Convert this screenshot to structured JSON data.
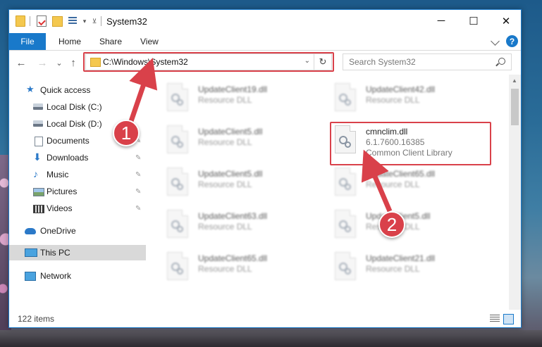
{
  "window": {
    "title": "System32",
    "controls": {
      "minimize": "─",
      "maximize": "☐",
      "close": "✕"
    }
  },
  "ribbon": {
    "file_tab": "File",
    "tabs": [
      "Home",
      "Share",
      "View"
    ],
    "help": "?"
  },
  "address_bar": {
    "path": "C:\\Windows\\System32",
    "refresh_glyph": "↻",
    "dropdown_glyph": "⌄",
    "search_placeholder": "Search System32"
  },
  "nav_buttons": {
    "back": "←",
    "forward": "→",
    "recent": "⌄",
    "up": "↑"
  },
  "nav_pane": {
    "items": [
      {
        "label": "Quick access",
        "icon": "star-icon",
        "pinned": false
      },
      {
        "label": "Local Disk (C:)",
        "icon": "drive-icon",
        "pinned": false
      },
      {
        "label": "Local Disk (D:)",
        "icon": "drive-icon",
        "pinned": false
      },
      {
        "label": "Documents",
        "icon": "documents-icon",
        "pinned": true
      },
      {
        "label": "Downloads",
        "icon": "download-icon",
        "pinned": true
      },
      {
        "label": "Music",
        "icon": "music-icon",
        "pinned": true
      },
      {
        "label": "Pictures",
        "icon": "pictures-icon",
        "pinned": true
      },
      {
        "label": "Videos",
        "icon": "videos-icon",
        "pinned": true
      },
      {
        "label": "OneDrive",
        "icon": "cloud-icon",
        "pinned": false
      },
      {
        "label": "This PC",
        "icon": "pc-icon",
        "pinned": false,
        "selected": true
      },
      {
        "label": "Network",
        "icon": "network-icon",
        "pinned": false
      }
    ],
    "pin_glyph": "📌"
  },
  "files": [
    {
      "name": "UpdateClient19.dll",
      "type": "Resource DLL"
    },
    {
      "name": "UpdateClient42.dll",
      "type": "Resource DLL"
    },
    {
      "name": "UpdateClient5.dll",
      "type": "Resource DLL"
    },
    {
      "name": "cmnclim.dll",
      "type": "6.1.7600.16385",
      "description": "Common Client Library",
      "highlighted": true
    },
    {
      "name": "UpdateClient5.dll",
      "type": "Resource DLL"
    },
    {
      "name": "UpdateClient65.dll",
      "type": "Resource DLL"
    },
    {
      "name": "UpdateClient63.dll",
      "type": "Resource DLL"
    },
    {
      "name": "UpdateClient5.dll",
      "type": "Resource DLL"
    },
    {
      "name": "UpdateClient65.dll",
      "type": "Resource DLL"
    },
    {
      "name": "UpdateClient21.dll",
      "type": "Resource DLL"
    }
  ],
  "status": {
    "item_count": "122 items"
  },
  "callouts": {
    "step1": "1",
    "step2": "2"
  },
  "colors": {
    "accent": "#1979ca",
    "callout_red": "#d9414a"
  }
}
